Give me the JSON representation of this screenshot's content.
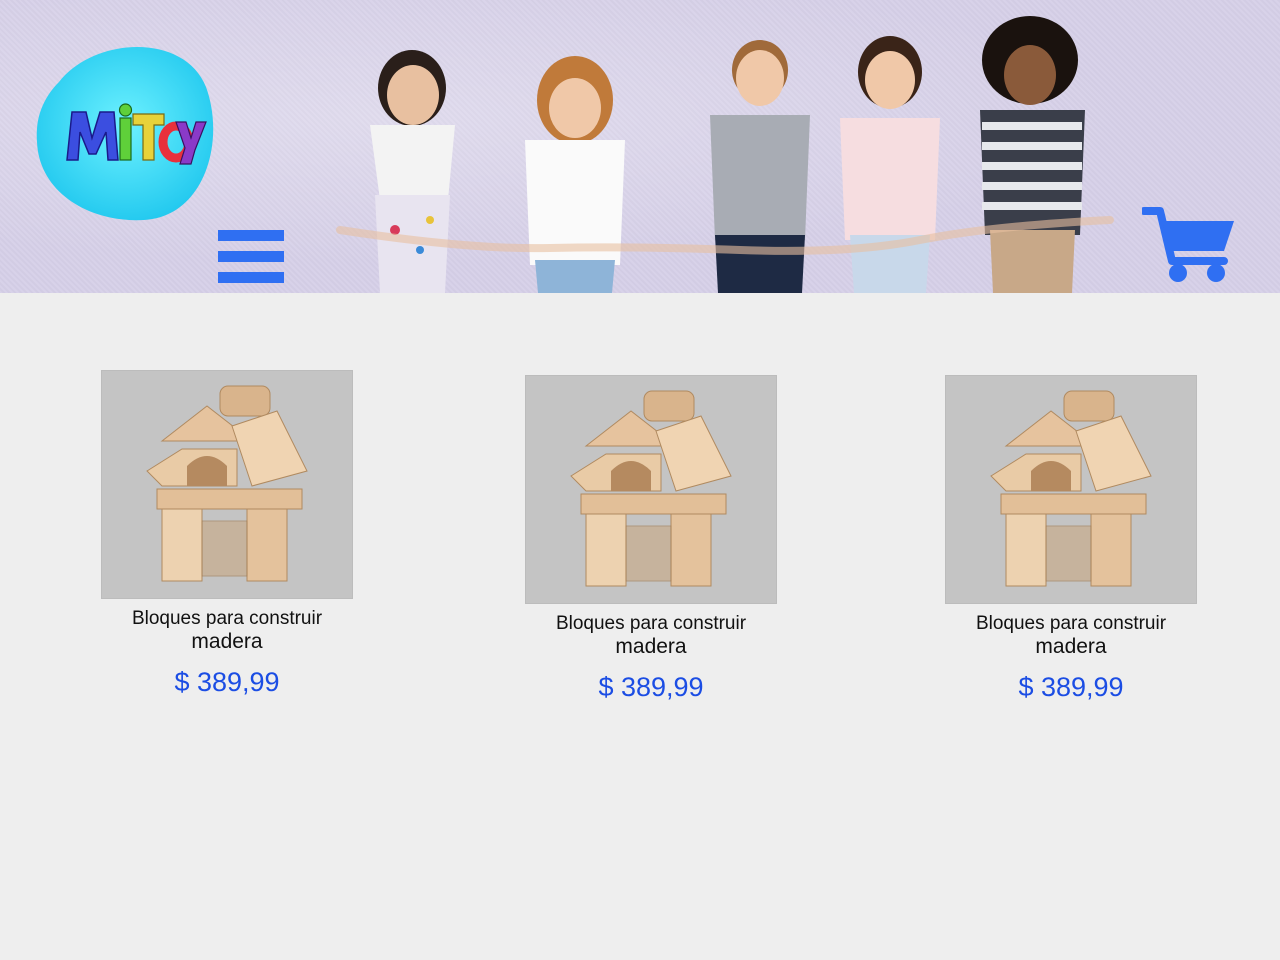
{
  "header": {
    "logo_text": "MiToy",
    "menu_icon": "hamburger-menu-icon",
    "cart_icon": "shopping-cart-icon",
    "accent_color": "#2f6ff2",
    "background_color": "#d6d0e8"
  },
  "products": [
    {
      "title": "Bloques para construir",
      "subtitle": "madera",
      "price": "$ 389,99"
    },
    {
      "title": "Bloques para construir",
      "subtitle": "madera",
      "price": "$ 389,99"
    },
    {
      "title": "Bloques para construir",
      "subtitle": "madera",
      "price": "$ 389,99"
    }
  ],
  "colors": {
    "price": "#1b4de4",
    "page_background": "#eeeeee",
    "image_background": "#c4c4c4"
  }
}
